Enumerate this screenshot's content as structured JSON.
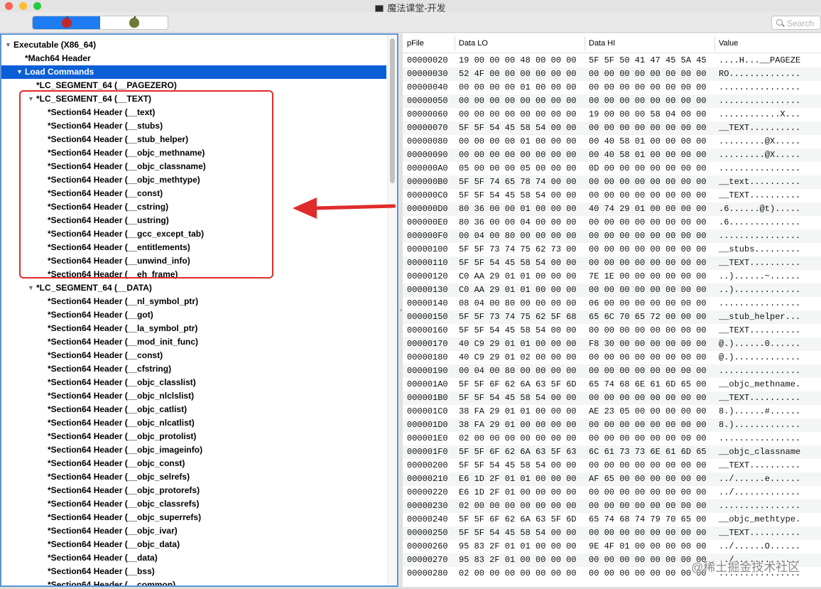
{
  "window": {
    "title": "魔法课堂-开发"
  },
  "toolbar": {
    "segments": [
      {
        "icon": "red-apple-icon",
        "active": true
      },
      {
        "icon": "green-apple-icon",
        "active": false
      }
    ],
    "search_placeholder": "Search"
  },
  "tree": {
    "items": [
      {
        "label": "Executable  (X86_64)",
        "level": 0,
        "disclosure": "▼",
        "selected": false
      },
      {
        "label": "*Mach64 Header",
        "level": 1,
        "disclosure": "",
        "selected": false
      },
      {
        "label": "Load Commands",
        "level": 1,
        "disclosure": "▼",
        "selected": true
      },
      {
        "label": "*LC_SEGMENT_64 (__PAGEZERO)",
        "level": 2,
        "disclosure": "",
        "selected": false
      },
      {
        "label": "*LC_SEGMENT_64 (__TEXT)",
        "level": 2,
        "disclosure": "▼",
        "selected": false
      },
      {
        "label": "*Section64 Header (__text)",
        "level": 3,
        "disclosure": "",
        "selected": false
      },
      {
        "label": "*Section64 Header (__stubs)",
        "level": 3,
        "disclosure": "",
        "selected": false
      },
      {
        "label": "*Section64 Header (__stub_helper)",
        "level": 3,
        "disclosure": "",
        "selected": false
      },
      {
        "label": "*Section64 Header (__objc_methname)",
        "level": 3,
        "disclosure": "",
        "selected": false
      },
      {
        "label": "*Section64 Header (__objc_classname)",
        "level": 3,
        "disclosure": "",
        "selected": false
      },
      {
        "label": "*Section64 Header (__objc_methtype)",
        "level": 3,
        "disclosure": "",
        "selected": false
      },
      {
        "label": "*Section64 Header (__const)",
        "level": 3,
        "disclosure": "",
        "selected": false
      },
      {
        "label": "*Section64 Header (__cstring)",
        "level": 3,
        "disclosure": "",
        "selected": false
      },
      {
        "label": "*Section64 Header (__ustring)",
        "level": 3,
        "disclosure": "",
        "selected": false
      },
      {
        "label": "*Section64 Header (__gcc_except_tab)",
        "level": 3,
        "disclosure": "",
        "selected": false
      },
      {
        "label": "*Section64 Header (__entitlements)",
        "level": 3,
        "disclosure": "",
        "selected": false
      },
      {
        "label": "*Section64 Header (__unwind_info)",
        "level": 3,
        "disclosure": "",
        "selected": false
      },
      {
        "label": "*Section64 Header (__eh_frame)",
        "level": 3,
        "disclosure": "",
        "selected": false
      },
      {
        "label": "*LC_SEGMENT_64 (__DATA)",
        "level": 2,
        "disclosure": "▼",
        "selected": false
      },
      {
        "label": "*Section64 Header (__nl_symbol_ptr)",
        "level": 3,
        "disclosure": "",
        "selected": false
      },
      {
        "label": "*Section64 Header (__got)",
        "level": 3,
        "disclosure": "",
        "selected": false
      },
      {
        "label": "*Section64 Header (__la_symbol_ptr)",
        "level": 3,
        "disclosure": "",
        "selected": false
      },
      {
        "label": "*Section64 Header (__mod_init_func)",
        "level": 3,
        "disclosure": "",
        "selected": false
      },
      {
        "label": "*Section64 Header (__const)",
        "level": 3,
        "disclosure": "",
        "selected": false
      },
      {
        "label": "*Section64 Header (__cfstring)",
        "level": 3,
        "disclosure": "",
        "selected": false
      },
      {
        "label": "*Section64 Header (__objc_classlist)",
        "level": 3,
        "disclosure": "",
        "selected": false
      },
      {
        "label": "*Section64 Header (__objc_nlclslist)",
        "level": 3,
        "disclosure": "",
        "selected": false
      },
      {
        "label": "*Section64 Header (__objc_catlist)",
        "level": 3,
        "disclosure": "",
        "selected": false
      },
      {
        "label": "*Section64 Header (__objc_nlcatlist)",
        "level": 3,
        "disclosure": "",
        "selected": false
      },
      {
        "label": "*Section64 Header (__objc_protolist)",
        "level": 3,
        "disclosure": "",
        "selected": false
      },
      {
        "label": "*Section64 Header (__objc_imageinfo)",
        "level": 3,
        "disclosure": "",
        "selected": false
      },
      {
        "label": "*Section64 Header (__objc_const)",
        "level": 3,
        "disclosure": "",
        "selected": false
      },
      {
        "label": "*Section64 Header (__objc_selrefs)",
        "level": 3,
        "disclosure": "",
        "selected": false
      },
      {
        "label": "*Section64 Header (__objc_protorefs)",
        "level": 3,
        "disclosure": "",
        "selected": false
      },
      {
        "label": "*Section64 Header (__objc_classrefs)",
        "level": 3,
        "disclosure": "",
        "selected": false
      },
      {
        "label": "*Section64 Header (__objc_superrefs)",
        "level": 3,
        "disclosure": "",
        "selected": false
      },
      {
        "label": "*Section64 Header (__objc_ivar)",
        "level": 3,
        "disclosure": "",
        "selected": false
      },
      {
        "label": "*Section64 Header (__objc_data)",
        "level": 3,
        "disclosure": "",
        "selected": false
      },
      {
        "label": "*Section64 Header (__data)",
        "level": 3,
        "disclosure": "",
        "selected": false
      },
      {
        "label": "*Section64 Header (__bss)",
        "level": 3,
        "disclosure": "",
        "selected": false
      },
      {
        "label": "*Section64 Header (__common)",
        "level": 3,
        "disclosure": "",
        "selected": false
      }
    ]
  },
  "hex": {
    "columns": [
      "pFile",
      "Data LO",
      "Data HI",
      "Value"
    ],
    "rows": [
      [
        "00000020",
        "19 00 00 00 48 00 00 00",
        "5F 5F 50 41 47 45 5A 45",
        "....H...__PAGEZE"
      ],
      [
        "00000030",
        "52 4F 00 00 00 00 00 00",
        "00 00 00 00 00 00 00 00",
        "RO.............."
      ],
      [
        "00000040",
        "00 00 00 00 01 00 00 00",
        "00 00 00 00 00 00 00 00",
        "................"
      ],
      [
        "00000050",
        "00 00 00 00 00 00 00 00",
        "00 00 00 00 00 00 00 00",
        "................"
      ],
      [
        "00000060",
        "00 00 00 00 00 00 00 00",
        "19 00 00 00 58 04 00 00",
        "............X..."
      ],
      [
        "00000070",
        "5F 5F 54 45 58 54 00 00",
        "00 00 00 00 00 00 00 00",
        "__TEXT.........."
      ],
      [
        "00000080",
        "00 00 00 00 01 00 00 00",
        "00 40 58 01 00 00 00 00",
        ".........@X....."
      ],
      [
        "00000090",
        "00 00 00 00 00 00 00 00",
        "00 40 58 01 00 00 00 00",
        ".........@X....."
      ],
      [
        "000000A0",
        "05 00 00 00 05 00 00 00",
        "0D 00 00 00 00 00 00 00",
        "................"
      ],
      [
        "000000B0",
        "5F 5F 74 65 78 74 00 00",
        "00 00 00 00 00 00 00 00",
        "__text.........."
      ],
      [
        "000000C0",
        "5F 5F 54 45 58 54 00 00",
        "00 00 00 00 00 00 00 00",
        "__TEXT.........."
      ],
      [
        "000000D0",
        "80 36 00 00 01 00 00 00",
        "40 74 29 01 00 00 00 00",
        ".6......@t)....."
      ],
      [
        "000000E0",
        "80 36 00 00 04 00 00 00",
        "00 00 00 00 00 00 00 00",
        ".6.............."
      ],
      [
        "000000F0",
        "00 04 00 80 00 00 00 00",
        "00 00 00 00 00 00 00 00",
        "................"
      ],
      [
        "00000100",
        "5F 5F 73 74 75 62 73 00",
        "00 00 00 00 00 00 00 00",
        "__stubs........."
      ],
      [
        "00000110",
        "5F 5F 54 45 58 54 00 00",
        "00 00 00 00 00 00 00 00",
        "__TEXT.........."
      ],
      [
        "00000120",
        "C0 AA 29 01 01 00 00 00",
        "7E 1E 00 00 00 00 00 00",
        "..)......~......"
      ],
      [
        "00000130",
        "C0 AA 29 01 01 00 00 00",
        "00 00 00 00 00 00 00 00",
        "..)............."
      ],
      [
        "00000140",
        "08 04 00 80 00 00 00 00",
        "06 00 00 00 00 00 00 00",
        "................"
      ],
      [
        "00000150",
        "5F 5F 73 74 75 62 5F 68",
        "65 6C 70 65 72 00 00 00",
        "__stub_helper..."
      ],
      [
        "00000160",
        "5F 5F 54 45 58 54 00 00",
        "00 00 00 00 00 00 00 00",
        "__TEXT.........."
      ],
      [
        "00000170",
        "40 C9 29 01 01 00 00 00",
        "F8 30 00 00 00 00 00 00",
        "@.)......0......"
      ],
      [
        "00000180",
        "40 C9 29 01 02 00 00 00",
        "00 00 00 00 00 00 00 00",
        "@.)............."
      ],
      [
        "00000190",
        "00 04 00 80 00 00 00 00",
        "00 00 00 00 00 00 00 00",
        "................"
      ],
      [
        "000001A0",
        "5F 5F 6F 62 6A 63 5F 6D",
        "65 74 68 6E 61 6D 65 00",
        "__objc_methname."
      ],
      [
        "000001B0",
        "5F 5F 54 45 58 54 00 00",
        "00 00 00 00 00 00 00 00",
        "__TEXT.........."
      ],
      [
        "000001C0",
        "38 FA 29 01 01 00 00 00",
        "AE 23 05 00 00 00 00 00",
        "8.)......#......"
      ],
      [
        "000001D0",
        "38 FA 29 01 00 00 00 00",
        "00 00 00 00 00 00 00 00",
        "8.)............."
      ],
      [
        "000001E0",
        "02 00 00 00 00 00 00 00",
        "00 00 00 00 00 00 00 00",
        "................"
      ],
      [
        "000001F0",
        "5F 5F 6F 62 6A 63 5F 63",
        "6C 61 73 73 6E 61 6D 65",
        "__objc_classname"
      ],
      [
        "00000200",
        "5F 5F 54 45 58 54 00 00",
        "00 00 00 00 00 00 00 00",
        "__TEXT.........."
      ],
      [
        "00000210",
        "E6 1D 2F 01 01 00 00 00",
        "AF 65 00 00 00 00 00 00",
        "../......e......"
      ],
      [
        "00000220",
        "E6 1D 2F 01 00 00 00 00",
        "00 00 00 00 00 00 00 00",
        "../............."
      ],
      [
        "00000230",
        "02 00 00 00 00 00 00 00",
        "00 00 00 00 00 00 00 00",
        "................"
      ],
      [
        "00000240",
        "5F 5F 6F 62 6A 63 5F 6D",
        "65 74 68 74 79 70 65 00",
        "__objc_methtype."
      ],
      [
        "00000250",
        "5F 5F 54 45 58 54 00 00",
        "00 00 00 00 00 00 00 00",
        "__TEXT.........."
      ],
      [
        "00000260",
        "95 83 2F 01 01 00 00 00",
        "9E 4F 01 00 00 00 00 00",
        "../......O......"
      ],
      [
        "00000270",
        "95 83 2F 01 00 00 00 00",
        "00 00 00 00 00 00 00 00",
        "../............."
      ],
      [
        "00000280",
        "02 00 00 00 00 00 00 00",
        "00 00 00 00 00 00 00 00",
        "................"
      ]
    ]
  },
  "watermark": "@稀土掘金技术社区",
  "colors": {
    "selection": "#0b5fd6",
    "annotation": "#e02b2b",
    "panel_border": "#5a95d6"
  }
}
